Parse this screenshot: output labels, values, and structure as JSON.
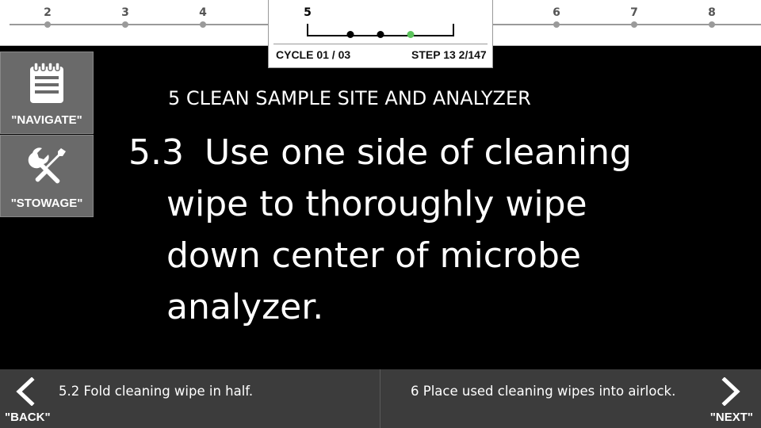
{
  "progress": {
    "steps": [
      {
        "label": "2",
        "current": false
      },
      {
        "label": "3",
        "current": false
      },
      {
        "label": "4",
        "current": false
      },
      {
        "label": "5",
        "current": true
      },
      {
        "label": "6",
        "current": false
      },
      {
        "label": "7",
        "current": false
      },
      {
        "label": "8",
        "current": false
      }
    ],
    "substeps_total": 3,
    "substep_active": 3,
    "cycle_label": "CYCLE 01 / 03",
    "step_label": "STEP 13 2/147"
  },
  "sidebar": {
    "navigate_label": "\"NAVIGATE\"",
    "navigate_icon": "notepad-icon",
    "stowage_label": "\"STOWAGE\"",
    "stowage_icon": "tools-icon"
  },
  "main": {
    "section_title": "5  CLEAN SAMPLE SITE AND ANALYZER",
    "step_number": "5.3",
    "step_lines": [
      "Use one side of cleaning",
      "wipe to thoroughly wipe",
      "down center of microbe",
      "analyzer."
    ]
  },
  "footer": {
    "back_text": "5.2  Fold cleaning wipe in half.",
    "back_key": "\"BACK\"",
    "next_text": "6  Place used cleaning wipes into airlock.",
    "next_key": "\"NEXT\""
  },
  "colors": {
    "background": "#000000",
    "sidebar_button": "#6a6a6a",
    "footer": "#3c3c3c",
    "active_substep": "#5cc35c"
  }
}
